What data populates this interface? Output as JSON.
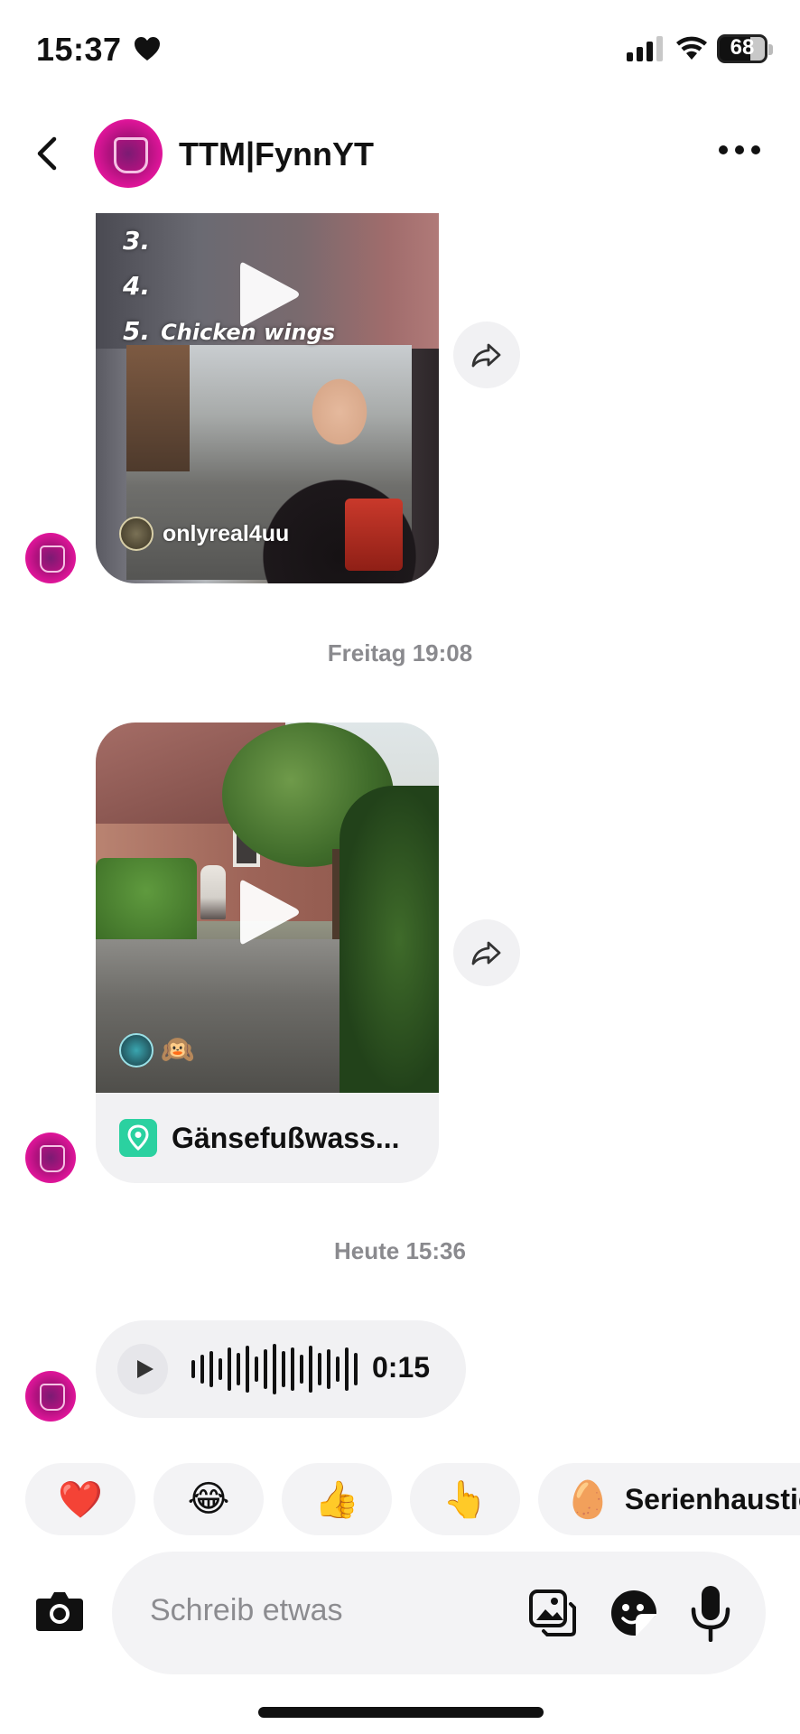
{
  "status_bar": {
    "time": "15:37",
    "battery": "68"
  },
  "header": {
    "contact_name": "TTM|FynnYT"
  },
  "messages": {
    "video1": {
      "list_items": [
        "3.",
        "4.",
        "5."
      ],
      "caption": "Chicken wings",
      "creator": "onlyreal4uu"
    },
    "timestamp1": "Freitag 19:08",
    "video2": {
      "emoji": "🙉",
      "location": "Gänsefußwass..."
    },
    "timestamp2": "Heute 15:36",
    "voice": {
      "duration": "0:15"
    }
  },
  "reactions": {
    "items": [
      "❤️",
      "😂",
      "👍",
      "👆"
    ],
    "suggestion_emoji": "🥚",
    "suggestion_label": "Serienhaustier"
  },
  "composer": {
    "placeholder": "Schreib etwas"
  },
  "colors": {
    "accent_pink": "#e0159a",
    "bubble_bg": "#f1f1f3",
    "timestamp_gray": "#8a8a8e",
    "location_green": "#2bd1a0"
  }
}
